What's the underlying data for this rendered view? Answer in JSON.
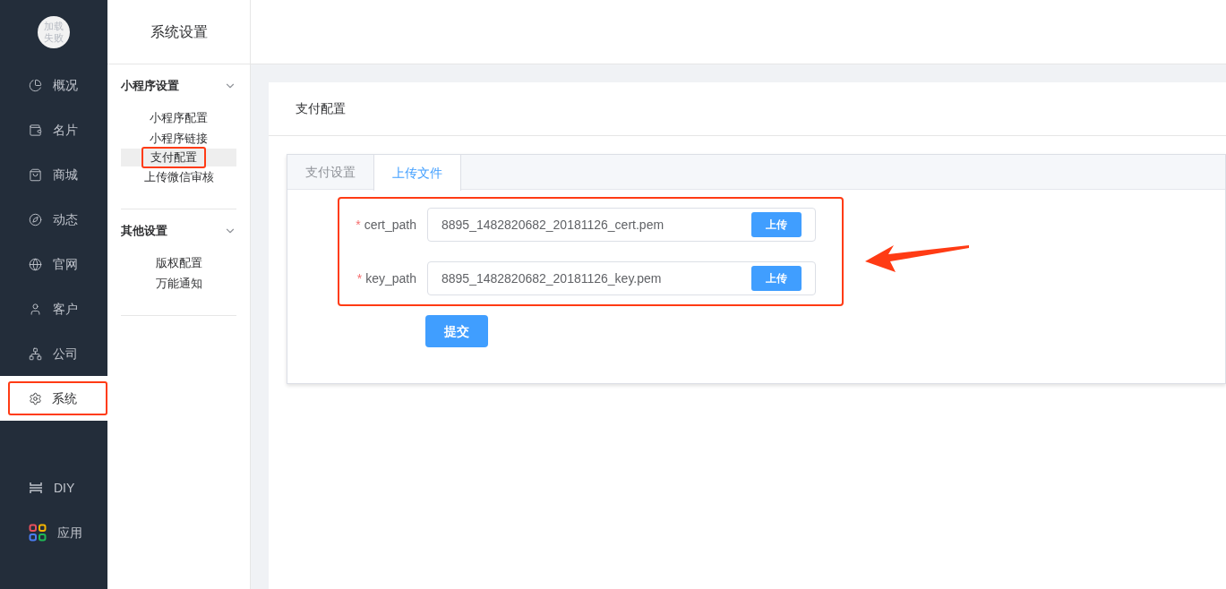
{
  "avatar": {
    "text": "加载失败"
  },
  "nav": [
    {
      "kind": "pie",
      "label": "概况",
      "selected": false
    },
    {
      "kind": "wallet",
      "label": "名片",
      "selected": false
    },
    {
      "kind": "bag",
      "label": "商城",
      "selected": false
    },
    {
      "kind": "compass",
      "label": "动态",
      "selected": false
    },
    {
      "kind": "globe",
      "label": "官网",
      "selected": false
    },
    {
      "kind": "user",
      "label": "客户",
      "selected": false
    },
    {
      "kind": "org",
      "label": "公司",
      "selected": false
    },
    {
      "kind": "gear",
      "label": "系统",
      "selected": true
    }
  ],
  "nav_bottom": [
    {
      "kind": "diy",
      "label": "DIY"
    },
    {
      "kind": "apps",
      "label": "应用"
    }
  ],
  "submenu": {
    "title": "系统设置",
    "groups": [
      {
        "title": "小程序设置",
        "expanded": true,
        "items": [
          {
            "label": "小程序配置",
            "selected": false
          },
          {
            "label": "小程序链接",
            "selected": false
          },
          {
            "label": "支付配置",
            "selected": true
          },
          {
            "label": "上传微信审核",
            "selected": false
          }
        ]
      },
      {
        "title": "其他设置",
        "expanded": true,
        "items": [
          {
            "label": "版权配置",
            "selected": false
          },
          {
            "label": "万能通知",
            "selected": false
          }
        ]
      }
    ]
  },
  "card": {
    "title": "支付配置",
    "tabs": [
      {
        "label": "支付设置",
        "selected": false
      },
      {
        "label": "上传文件",
        "selected": true
      }
    ],
    "fields": [
      {
        "label": "cert_path",
        "required_mark": "*",
        "value": "8895_1482820682_20181126_cert.pem",
        "button": "上传"
      },
      {
        "label": "key_path",
        "required_mark": "*",
        "value": "8895_1482820682_20181126_key.pem",
        "button": "上传"
      }
    ],
    "submit": "提交"
  }
}
